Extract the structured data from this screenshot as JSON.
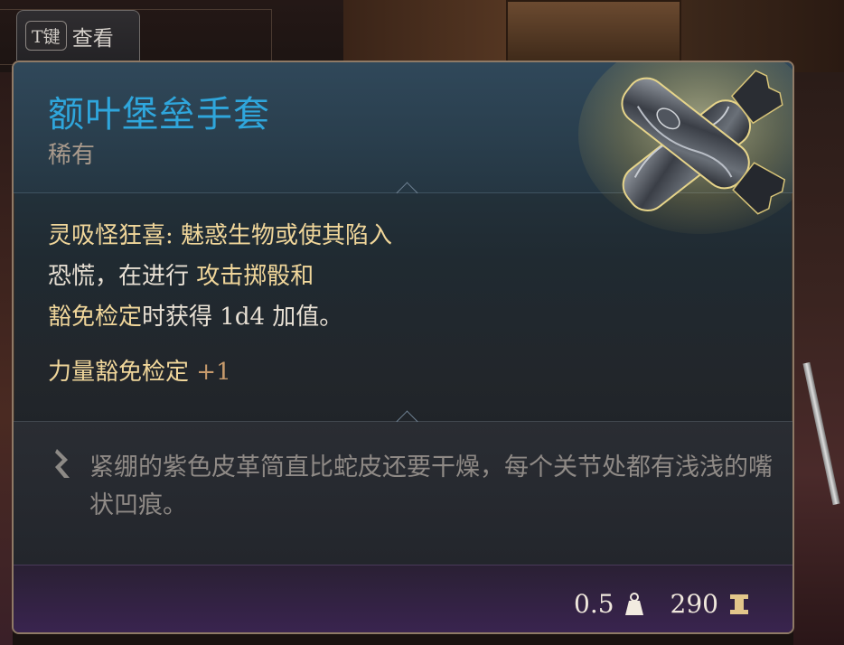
{
  "keybind": {
    "key": "T键",
    "label": "查看"
  },
  "item": {
    "name": "额叶堡垒手套",
    "rarity": "稀有",
    "description": {
      "line1_title": "灵吸怪狂喜:",
      "line1_rest": " 魅惑生物或使其陷入",
      "line2_pre": "恐慌，在进行 ",
      "line2_hl": "攻击掷骰和",
      "line3_hl": "豁免检定",
      "line3_rest": "时获得 1d4 加值。"
    },
    "bonus": {
      "label": "力量豁免检定",
      "value": "+1"
    },
    "lore": "紧绷的紫色皮革简直比蛇皮还要干燥，每个关节处都有浅浅的嘴状凹痕。",
    "weight": "0.5",
    "value": "290"
  },
  "colors": {
    "title": "#2fa6dc",
    "highlight": "#f0d69a",
    "bonus_value": "#c79a6c",
    "lore_text": "#8f8a86"
  },
  "icons": {
    "weight": "weight-icon",
    "gold": "gold-icon",
    "lore": "lore-quill-icon"
  }
}
